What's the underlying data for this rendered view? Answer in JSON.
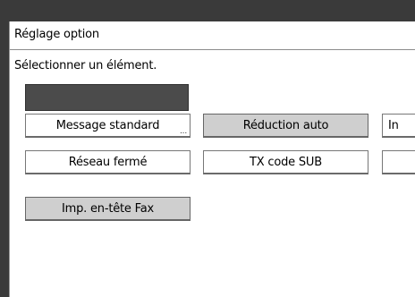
{
  "window": {
    "title": "Réglage option",
    "instruction": "Sélectionner un élément."
  },
  "options": [
    {
      "label": "Message standard",
      "selected": false,
      "has_more": true
    },
    {
      "label": "Réduction auto",
      "selected": true,
      "has_more": false
    },
    {
      "label": "In",
      "selected": false,
      "has_more": false
    },
    {
      "label": "Réseau fermé",
      "selected": false,
      "has_more": false
    },
    {
      "label": "TX code SUB",
      "selected": false,
      "has_more": false
    },
    {
      "label": "",
      "selected": false,
      "has_more": false
    },
    {
      "label": "Imp. en-tête Fax",
      "selected": true,
      "has_more": false
    }
  ],
  "more_indicator": "..."
}
